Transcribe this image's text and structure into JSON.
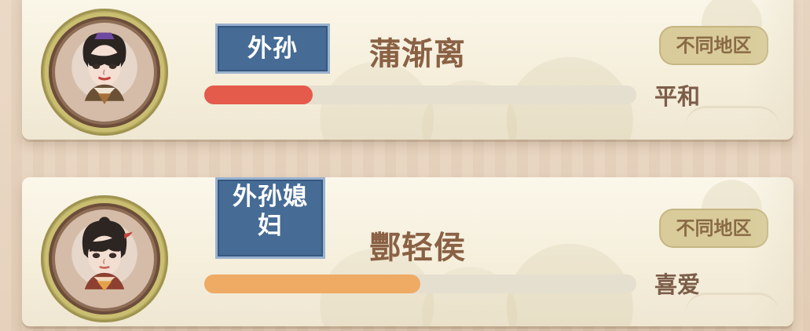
{
  "cards": [
    {
      "relation": "外孙",
      "name": "蒲渐离",
      "region": "不同地区",
      "attitude": "平和",
      "affinity_ratio": 0.25,
      "bar_color": "#e45a4b"
    },
    {
      "relation": "外孙媳妇",
      "name": "酆轻侯",
      "region": "不同地区",
      "attitude": "喜爱",
      "affinity_ratio": 0.5,
      "bar_color": "#efaa64"
    }
  ]
}
